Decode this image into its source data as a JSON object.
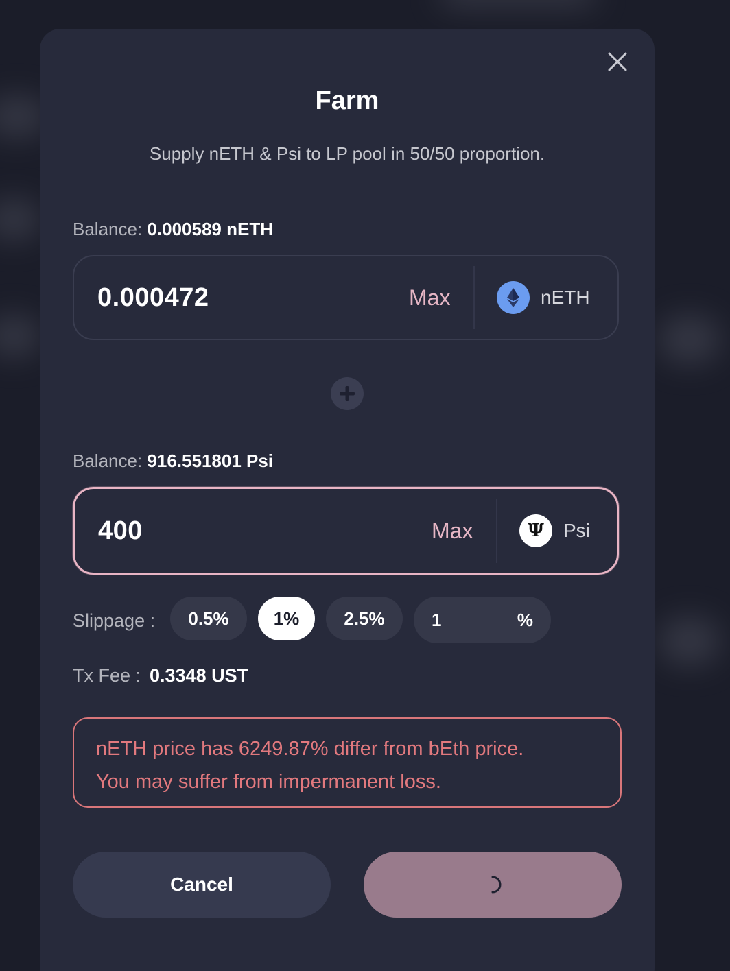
{
  "modal": {
    "title": "Farm",
    "subtitle": "Supply nETH & Psi to LP pool in 50/50 proportion."
  },
  "token_a": {
    "balance_label": "Balance:",
    "balance_value": "0.000589 nETH",
    "amount": "0.000472",
    "max_label": "Max",
    "symbol": "nETH",
    "icon": "ethereum-icon",
    "icon_color": "#6b9cf0"
  },
  "token_b": {
    "balance_label": "Balance:",
    "balance_value": "916.551801 Psi",
    "amount": "400",
    "max_label": "Max",
    "symbol": "Psi",
    "icon": "psi-icon",
    "icon_glyph": "Ψ",
    "focused": true
  },
  "slippage": {
    "label": "Slippage :",
    "options": [
      "0.5%",
      "1%",
      "2.5%"
    ],
    "selected": "1%",
    "custom_value": "1",
    "custom_unit": "%"
  },
  "tx_fee": {
    "label": "Tx Fee :",
    "value": "0.3348 UST"
  },
  "warning": {
    "line1": "nETH price has 6249.87% differ from bEth price.",
    "line2": "You may suffer from impermanent loss.",
    "color": "#e2797e"
  },
  "actions": {
    "cancel_label": "Cancel",
    "confirm_state": "loading",
    "confirm_color": "#997b8c"
  },
  "colors": {
    "accent_pink": "#e8b4c4",
    "modal_bg": "#272a3b"
  }
}
